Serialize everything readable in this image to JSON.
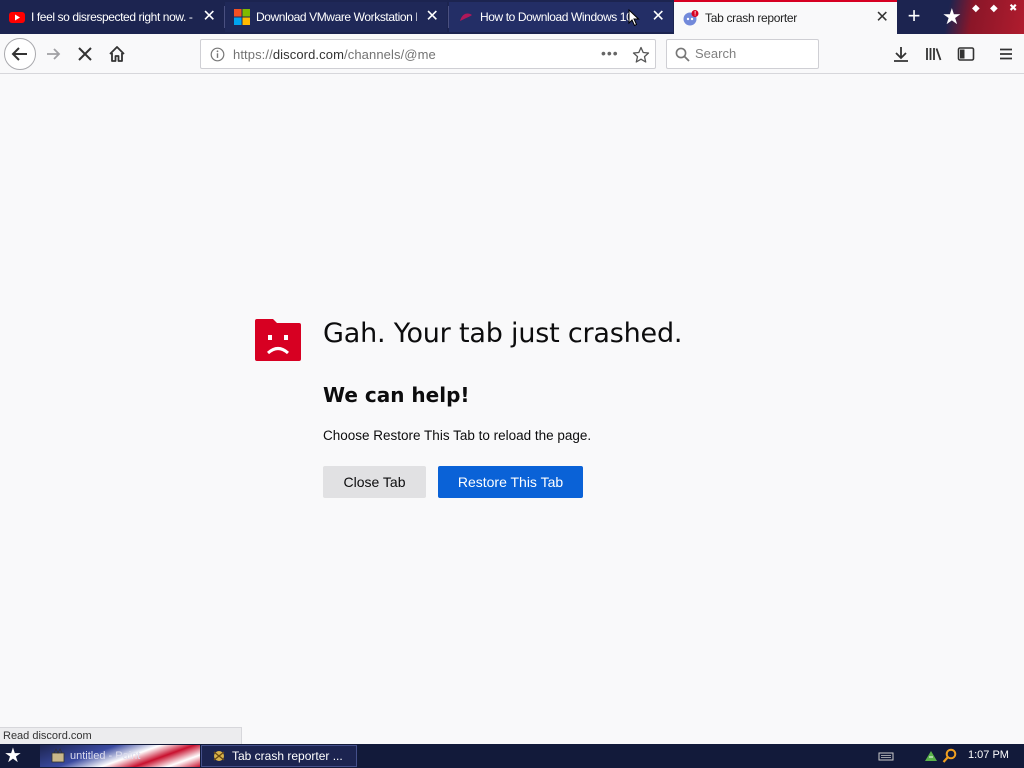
{
  "tabs": [
    {
      "title": "I feel so disrespected right now. -",
      "icon": "youtube-icon",
      "close": "✕"
    },
    {
      "title": "Download VMware Workstation Pro",
      "icon": "microsoft-icon",
      "close": "✕"
    },
    {
      "title": "How to Download Windows 10",
      "icon": "site-favicon-icon",
      "close": "✕"
    },
    {
      "title": "Tab crash reporter",
      "icon": "discord-icon",
      "close": "✕",
      "badge": "!"
    }
  ],
  "new_tab_label": "+",
  "navbar": {
    "url_scheme": "https://",
    "url_host": "discord.com",
    "url_path": "/channels/@me",
    "page_actions": "•••",
    "search_placeholder": "Search"
  },
  "crash": {
    "title": "Gah. Your tab just crashed.",
    "heading": "We can help!",
    "text": "Choose Restore This Tab to reload the page.",
    "close_button": "Close Tab",
    "restore_button": "Restore This Tab"
  },
  "status_text": "Read discord.com",
  "taskbar": {
    "task_1": "untitled - Paint",
    "task_2": "Tab crash reporter ...",
    "clock": "1:07 PM"
  },
  "colors": {
    "accent": "#0a62d7",
    "crash_red": "#d70022",
    "tabstrip": "#1c2450"
  }
}
